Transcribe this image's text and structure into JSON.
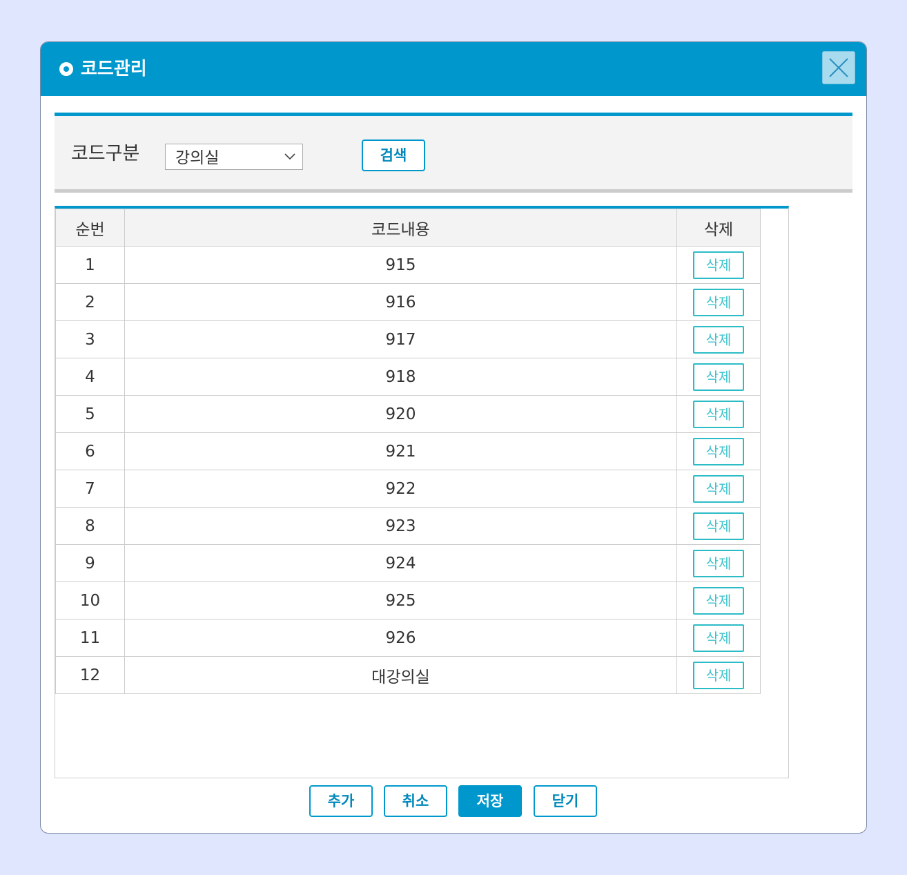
{
  "dialog": {
    "title": "코드관리"
  },
  "search": {
    "label": "코드구분",
    "selected": "강의실",
    "search_button": "검색"
  },
  "table": {
    "headers": [
      "순번",
      "코드내용",
      "삭제"
    ],
    "rows": [
      {
        "seq": "1",
        "content": "915",
        "action": "삭제"
      },
      {
        "seq": "2",
        "content": "916",
        "action": "삭제"
      },
      {
        "seq": "3",
        "content": "917",
        "action": "삭제"
      },
      {
        "seq": "4",
        "content": "918",
        "action": "삭제"
      },
      {
        "seq": "5",
        "content": "920",
        "action": "삭제"
      },
      {
        "seq": "6",
        "content": "921",
        "action": "삭제"
      },
      {
        "seq": "7",
        "content": "922",
        "action": "삭제"
      },
      {
        "seq": "8",
        "content": "923",
        "action": "삭제"
      },
      {
        "seq": "9",
        "content": "924",
        "action": "삭제"
      },
      {
        "seq": "10",
        "content": "925",
        "action": "삭제"
      },
      {
        "seq": "11",
        "content": "926",
        "action": "삭제"
      },
      {
        "seq": "12",
        "content": "대강의실",
        "action": "삭제"
      }
    ]
  },
  "footer": {
    "add": "추가",
    "cancel": "취소",
    "save": "저장",
    "close": "닫기"
  },
  "colors": {
    "accent": "#0098cc",
    "delete_button": "#2cbcc6",
    "page_background": "#dfe6fd"
  }
}
